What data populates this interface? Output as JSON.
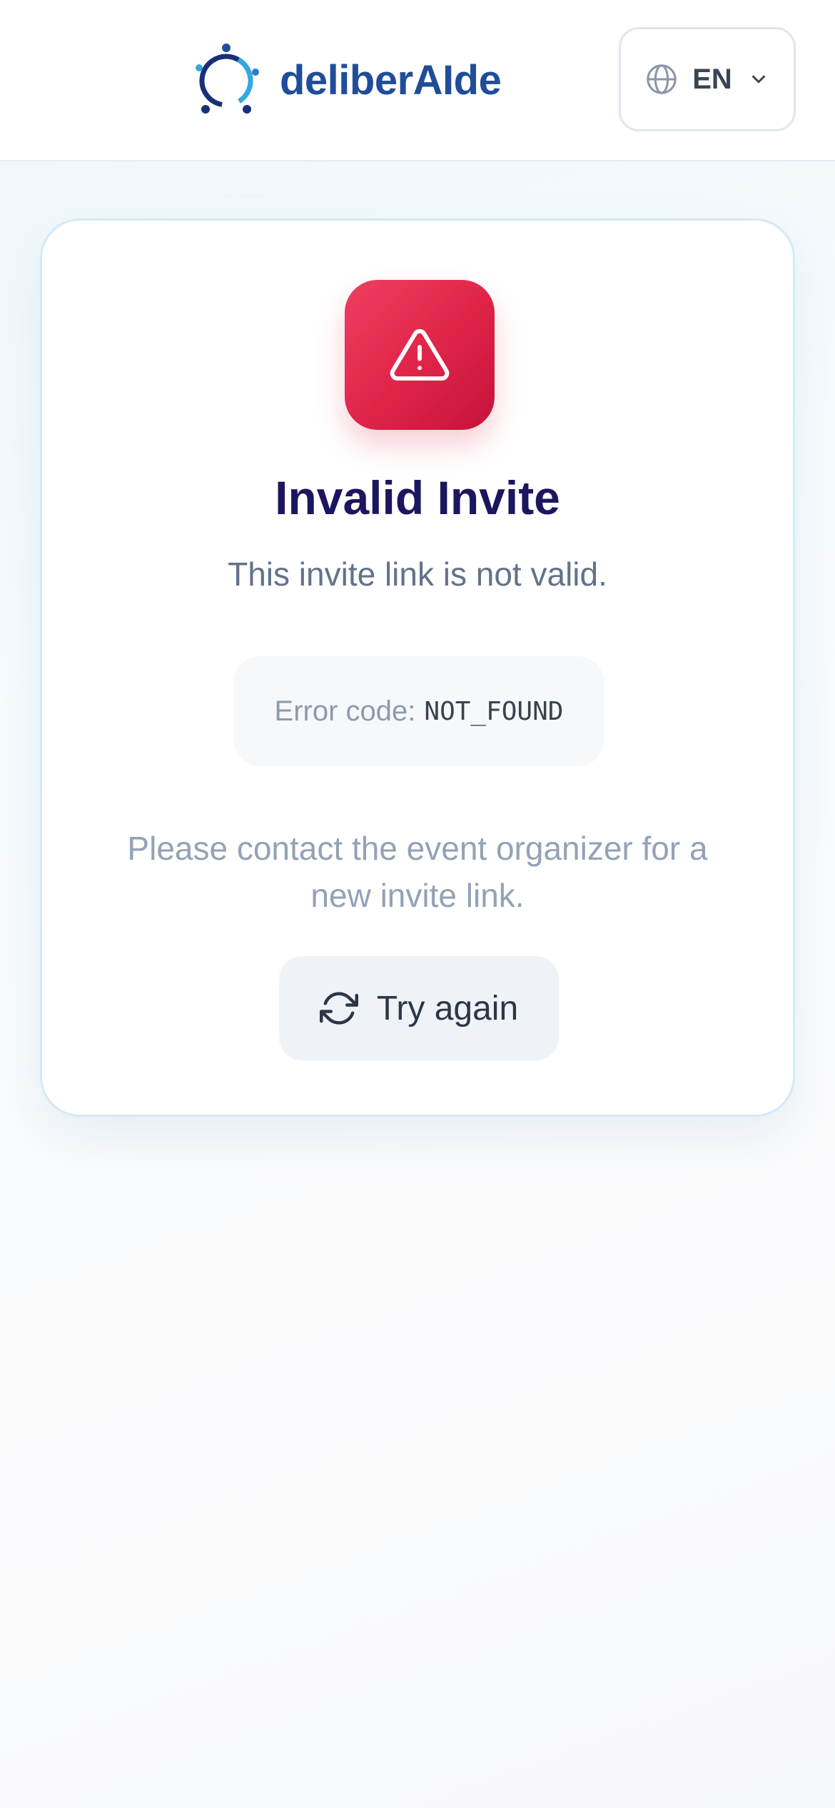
{
  "header": {
    "brand_name": "deliberAIde",
    "language": {
      "code": "EN",
      "icon": "globe-icon",
      "chevron": "chevron-down-icon"
    }
  },
  "card": {
    "status_icon": "alert-triangle-icon",
    "title": "Invalid Invite",
    "subtitle": "This invite link is not valid.",
    "error": {
      "label": "Error code:",
      "code": "NOT_FOUND"
    },
    "help_text": "Please contact the event organizer for a new invite link.",
    "retry_button": {
      "label": "Try again",
      "icon": "refresh-icon"
    }
  },
  "colors": {
    "brand": "#1f4d9a",
    "title": "#1c1660",
    "alert_start": "#ef3f60",
    "alert_end": "#c5133a",
    "card_border": "#d3eaf7"
  }
}
